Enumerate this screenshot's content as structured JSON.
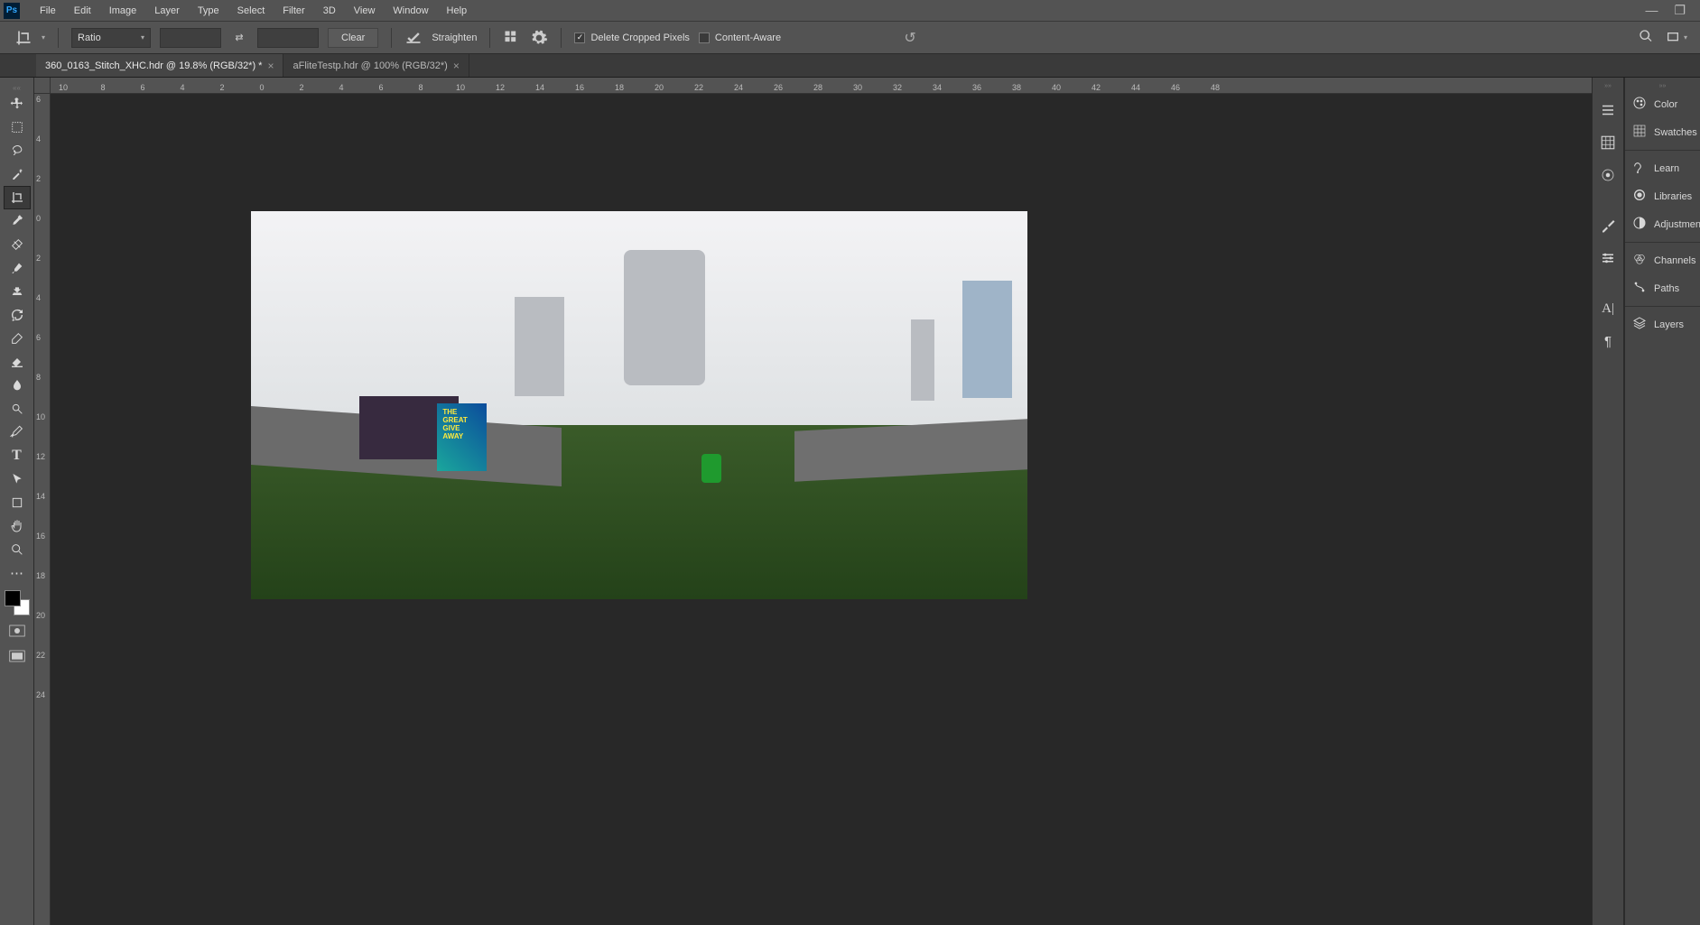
{
  "menu": {
    "items": [
      "File",
      "Edit",
      "Image",
      "Layer",
      "Type",
      "Select",
      "Filter",
      "3D",
      "View",
      "Window",
      "Help"
    ]
  },
  "options": {
    "ratio_label": "Ratio",
    "clear_label": "Clear",
    "straighten_label": "Straighten",
    "delete_cropped_label": "Delete Cropped Pixels",
    "delete_cropped_checked": true,
    "content_aware_label": "Content-Aware",
    "content_aware_checked": false
  },
  "tabs": [
    {
      "label": "360_0163_Stitch_XHC.hdr @ 19.8% (RGB/32*) *",
      "active": true
    },
    {
      "label": "aFliteTestp.hdr @ 100% (RGB/32*)",
      "active": false
    }
  ],
  "rulers": {
    "h": [
      "10",
      "8",
      "6",
      "4",
      "2",
      "0",
      "2",
      "4",
      "6",
      "8",
      "10",
      "12",
      "14",
      "16",
      "18",
      "20",
      "22",
      "24",
      "26",
      "28",
      "30",
      "32",
      "34",
      "36",
      "38",
      "40",
      "42",
      "44",
      "46",
      "48"
    ],
    "v": [
      "6",
      "4",
      "2",
      "0",
      "2",
      "4",
      "6",
      "8",
      "10",
      "12",
      "14",
      "16",
      "18",
      "20",
      "22",
      "24"
    ]
  },
  "ad_text": "THE GREAT GIVE AWAY",
  "collapsed_dock": [
    "history-icon",
    "properties-icon",
    "typography-icon",
    "brushes-icon",
    "options-icon",
    "character-icon",
    "paragraph-icon"
  ],
  "panels": [
    {
      "icon": "color-icon",
      "label": "Color"
    },
    {
      "icon": "swatches-icon",
      "label": "Swatches"
    },
    {
      "sep": true
    },
    {
      "icon": "learn-icon",
      "label": "Learn"
    },
    {
      "icon": "libraries-icon",
      "label": "Libraries"
    },
    {
      "icon": "adjustments-icon",
      "label": "Adjustments"
    },
    {
      "sep": true
    },
    {
      "icon": "channels-icon",
      "label": "Channels"
    },
    {
      "icon": "paths-icon",
      "label": "Paths"
    },
    {
      "sep": true
    },
    {
      "icon": "layers-icon",
      "label": "Layers"
    }
  ],
  "tools": [
    "move",
    "rect-select",
    "lasso",
    "magic-wand",
    "crop",
    "eyedropper",
    "healing",
    "brush",
    "clone",
    "history-brush",
    "eraser",
    "bucket",
    "blur",
    "dodge",
    "pen",
    "type",
    "path-select",
    "shape",
    "hand",
    "zoom"
  ]
}
